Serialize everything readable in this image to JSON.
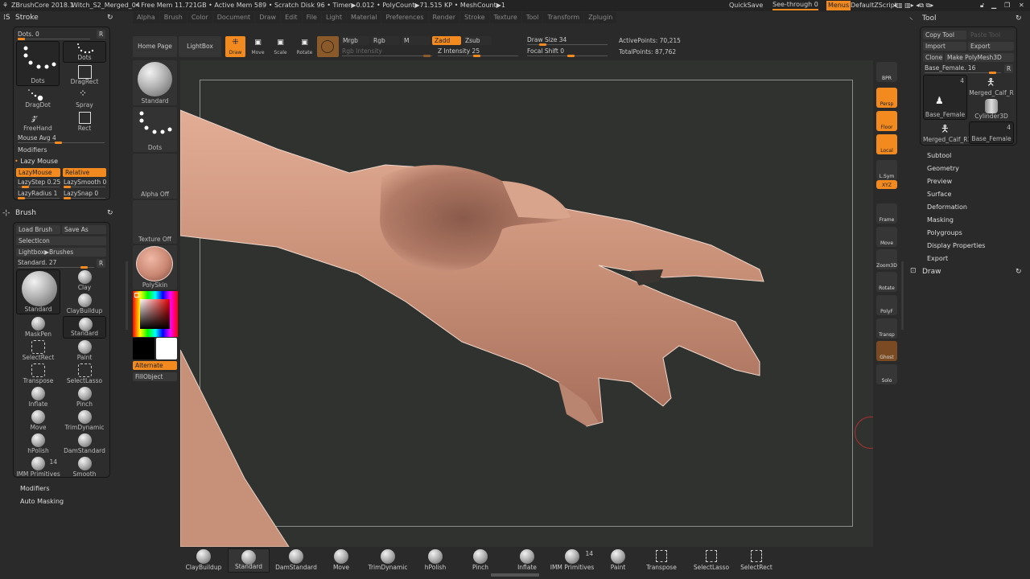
{
  "titlebar": {
    "app": "ZBrushCore 2018.1",
    "document": "Witch_S2_Merged_04",
    "stats": "• Free Mem 11.721GB • Active Mem 589 • Scratch Disk 96 • Timer▶0.012 • PolyCount▶71.515 KP • MeshCount▶1",
    "quicksave": "QuickSave",
    "seethrough": "See-through  0",
    "seethrough_value": 0,
    "menus": "Menus",
    "script": "DefaultZScript"
  },
  "menubar": [
    "Alpha",
    "Brush",
    "Color",
    "Document",
    "Draw",
    "Edit",
    "File",
    "Light",
    "Material",
    "Preferences",
    "Render",
    "Stroke",
    "Texture",
    "Tool",
    "Transform",
    "Zplugin"
  ],
  "stroke": {
    "title": "Stroke",
    "dots_slider": "Dots. 0",
    "r": "R",
    "tiles": [
      "Dots",
      "Dots",
      "DragRect",
      "DragDot",
      "Spray",
      "FreeHand",
      "Rect"
    ],
    "mouse_avg": "Mouse Avg 4",
    "modifiers": "Modifiers",
    "lazy_mouse": "Lazy Mouse",
    "lazymouse_btn": "LazyMouse",
    "relative_btn": "Relative",
    "lazystep": "LazyStep 0.25",
    "lazysmooth": "LazySmooth 0",
    "lazyradius": "LazyRadius 1",
    "lazysnap": "LazySnap 0"
  },
  "brush": {
    "title": "Brush",
    "load": "Load Brush",
    "save_as": "Save As",
    "select_icon": "SelectIcon",
    "lightbox_brushes": "Lightbox▶Brushes",
    "slider": "Standard. 27",
    "r": "R",
    "items": [
      "Standard",
      "Clay",
      "ClayBuildup",
      "MaskPen",
      "Standard",
      "SelectRect",
      "Paint",
      "Transpose",
      "SelectLasso",
      "Inflate",
      "Pinch",
      "Move",
      "TrimDynamic",
      "hPolish",
      "DamStandard",
      "IMM Primitives",
      "Smooth"
    ],
    "imm_count": "14",
    "modifiers": "Modifiers",
    "auto_masking": "Auto Masking"
  },
  "quick": {
    "home": "Home Page",
    "lightbox": "LightBox",
    "brush": "Standard",
    "stroke": "Dots",
    "alpha": "Alpha Off",
    "texture": "Texture Off",
    "material": "PolySkin",
    "alternate": "Alternate",
    "fillobject": "FillObject",
    "main_color": "#000000",
    "secondary_color": "#ffffff"
  },
  "toolbar": {
    "draw": "Draw",
    "move": "Move",
    "scale": "Scale",
    "rotate": "Rotate",
    "mrgb": "Mrgb",
    "rgb": "Rgb",
    "m": "M",
    "zadd": "Zadd",
    "zsub": "Zsub",
    "rgb_intensity": "Rgb Intensity",
    "z_intensity": "Z Intensity 25",
    "draw_size": "Draw Size 34",
    "focal_shift": "Focal Shift 0",
    "active_points": "ActivePoints: 70,215",
    "total_points": "TotalPoints: 87,762"
  },
  "shelf": [
    "BPR",
    "Persp",
    "Floor",
    "Local",
    "L.Sym",
    "XYZ",
    "Frame",
    "Move",
    "Zoom3D",
    "Rotate",
    "PolyF",
    "Transp",
    "Ghost",
    "Solo"
  ],
  "tool": {
    "title": "Tool",
    "copy": "Copy Tool",
    "paste": "Paste Tool",
    "import": "Import",
    "export": "Export",
    "clone": "Clone",
    "make_polymesh": "Make PolyMesh3D",
    "slider": "Base_Female. 16",
    "r": "R",
    "thumbs": [
      "Base_Female",
      "Merged_Calf_R",
      "Cylinder3D",
      "Merged_Calf_R1",
      "Base_Female"
    ],
    "count1": "4",
    "count2": "4",
    "sections": [
      "Subtool",
      "Geometry",
      "Preview",
      "Surface",
      "Deformation",
      "Masking",
      "Polygroups",
      "Display Properties",
      "Export"
    ],
    "draw_palette": "Draw"
  },
  "bottom_shelf": [
    "ClayBuildup",
    "Standard",
    "DamStandard",
    "Move",
    "TrimDynamic",
    "hPolish",
    "Pinch",
    "Inflate",
    "IMM Primitives",
    "Paint",
    "Transpose",
    "SelectLasso",
    "SelectRect"
  ],
  "bottom_imm_count": "14",
  "colors": {
    "accent": "#f28a1f",
    "viewport": "#2f322f",
    "skin": "#c8917a"
  }
}
